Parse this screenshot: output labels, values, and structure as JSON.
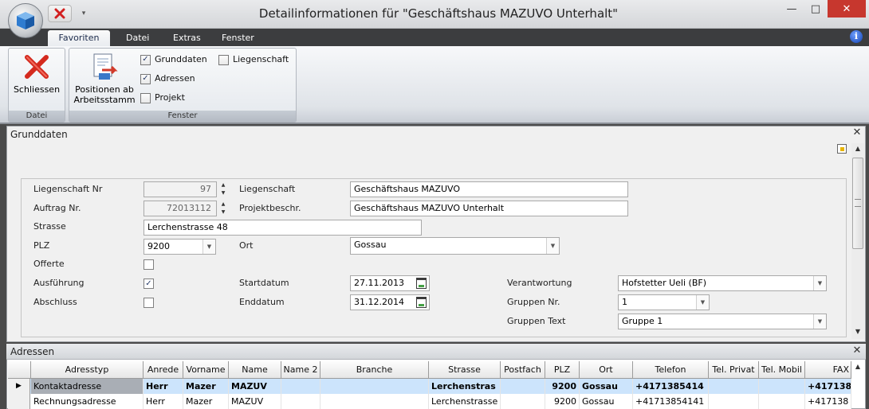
{
  "window": {
    "title": "Detailinformationen für \"Geschäftshaus MAZUVO Unterhalt\"",
    "minimize": "—",
    "maximize": "□",
    "close": "✕"
  },
  "ribbon": {
    "tabs": [
      "Favoriten",
      "Datei",
      "Extras",
      "Fenster"
    ],
    "help": "i",
    "groups": {
      "datei": {
        "label": "Datei",
        "close_button": "Schliessen"
      },
      "fenster": {
        "label": "Fenster",
        "positionen_line1": "Positionen ab",
        "positionen_line2": "Arbeitsstamm",
        "checks": [
          {
            "label": "Grunddaten",
            "checked": true
          },
          {
            "label": "Adressen",
            "checked": true
          },
          {
            "label": "Projekt",
            "checked": false
          },
          {
            "label": "Liegenschaft",
            "checked": false
          }
        ]
      }
    }
  },
  "grunddaten": {
    "title": "Grunddaten",
    "close": "✕",
    "labels": {
      "liegenschaft_nr": "Liegenschaft Nr",
      "auftrag_nr": "Auftrag Nr.",
      "strasse": "Strasse",
      "plz": "PLZ",
      "offerte": "Offerte",
      "ausfuehrung": "Ausführung",
      "abschluss": "Abschluss",
      "liegenschaft": "Liegenschaft",
      "projektbeschr": "Projektbeschr.",
      "ort": "Ort",
      "startdatum": "Startdatum",
      "enddatum": "Enddatum",
      "verantwortung": "Verantwortung",
      "gruppen_nr": "Gruppen Nr.",
      "gruppen_text": "Gruppen Text"
    },
    "values": {
      "liegenschaft_nr": "97",
      "auftrag_nr": "72013112",
      "strasse": "Lerchenstrasse 48",
      "plz": "9200",
      "liegenschaft": "Geschäftshaus MAZUVO",
      "projektbeschr": "Geschäftshaus MAZUVO Unterhalt",
      "ort": "Gossau",
      "startdatum": "27.11.2013",
      "enddatum": "31.12.2014",
      "verantwortung": "Hofstetter Ueli (BF)",
      "gruppen_nr": "1",
      "gruppen_text": "Gruppe 1",
      "offerte": false,
      "ausfuehrung": true,
      "abschluss": false
    }
  },
  "adressen": {
    "title": "Adressen",
    "close": "✕",
    "columns": [
      "Adresstyp",
      "Anrede",
      "Vorname",
      "Name",
      "Name 2",
      "Branche",
      "Strasse",
      "Postfach",
      "PLZ",
      "Ort",
      "Telefon",
      "Tel. Privat",
      "Tel. Mobil",
      "FAX"
    ],
    "rows": [
      [
        "Kontaktadresse",
        "Herr",
        "Mazer",
        "MAZUV",
        "",
        "",
        "Lerchenstras",
        "",
        "9200",
        "Gossau",
        "+4171385414",
        "",
        "",
        "+417138"
      ],
      [
        "Rechnungsadresse",
        "Herr",
        "Mazer",
        "MAZUV",
        "",
        "",
        "Lerchenstrasse",
        "",
        "9200",
        "Gossau",
        "+41713854141",
        "",
        "",
        "+417138"
      ]
    ],
    "current_row_marker": "▶"
  },
  "colors": {
    "accent_selected_row": "#cce4fc",
    "close_red": "#c7372e",
    "ribbon_dark": "#3c3d3f"
  }
}
